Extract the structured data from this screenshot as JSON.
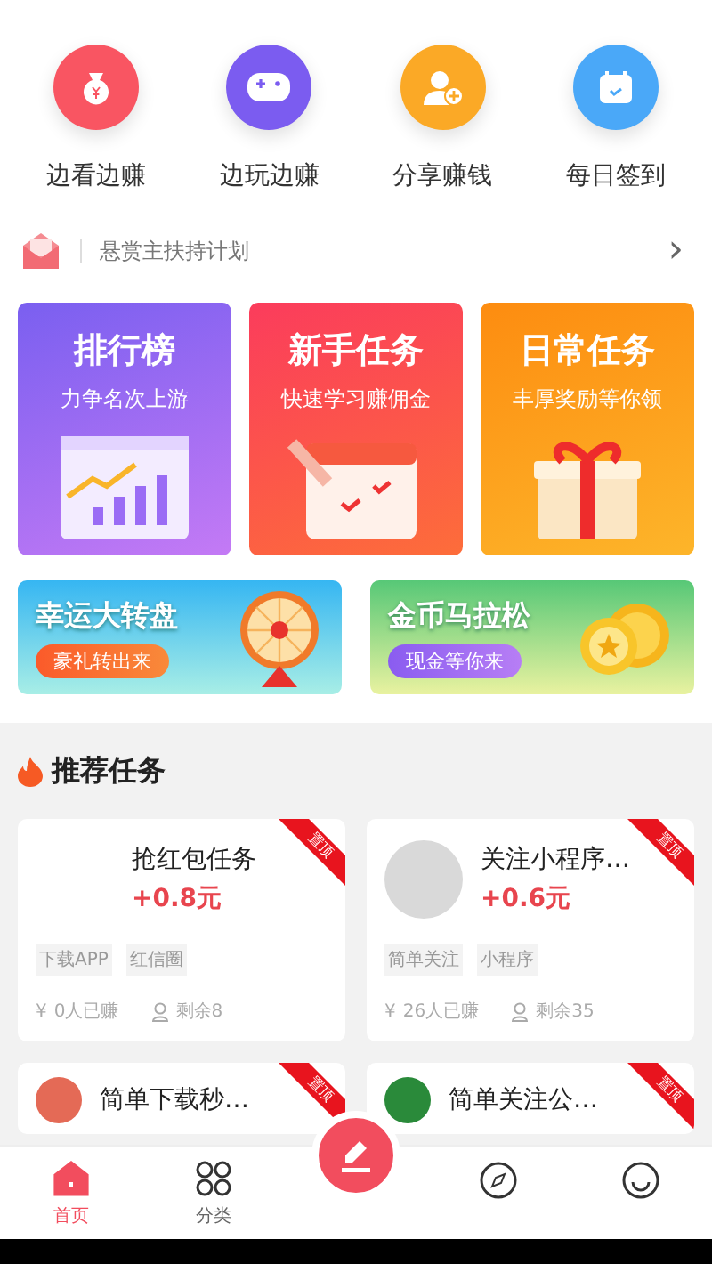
{
  "quick_actions": [
    {
      "label": "边看边赚"
    },
    {
      "label": "边玩边赚"
    },
    {
      "label": "分享赚钱"
    },
    {
      "label": "每日签到"
    }
  ],
  "notice": {
    "text": "悬赏主扶持计划",
    "chevron": "›"
  },
  "feature_cards": [
    {
      "title": "排行榜",
      "subtitle": "力争名次上游"
    },
    {
      "title": "新手任务",
      "subtitle": "快速学习赚佣金"
    },
    {
      "title": "日常任务",
      "subtitle": "丰厚奖励等你领"
    }
  ],
  "promo_banners": [
    {
      "title": "幸运大转盘",
      "button": "豪礼转出来"
    },
    {
      "title": "金币马拉松",
      "button": "现金等你来"
    }
  ],
  "section": {
    "title": "推荐任务"
  },
  "tasks": [
    {
      "title": "抢红包任务",
      "reward": "+0.8元",
      "tags": [
        "下载APP",
        "红信圈"
      ],
      "yen": "¥",
      "earned": "0人已赚",
      "remaining": "剩余8",
      "pinned": true,
      "ribbon": "置顶",
      "avatar": false
    },
    {
      "title": "关注小程序…",
      "reward": "+0.6元",
      "tags": [
        "简单关注",
        "小程序"
      ],
      "yen": "¥",
      "earned": "26人已赚",
      "remaining": "剩余35",
      "pinned": true,
      "ribbon": "置顶",
      "avatar": true
    },
    {
      "title": "简单下载秒…",
      "pinned": true,
      "ribbon": "置顶",
      "avatar": true
    },
    {
      "title": "简单关注公…",
      "pinned": true,
      "ribbon": "置顶",
      "avatar": true
    }
  ],
  "bottom_nav": [
    {
      "kind": "tab",
      "label": "首页",
      "selected": true
    },
    {
      "kind": "tab",
      "label": "分类",
      "selected": false
    },
    {
      "kind": "post",
      "selected": false
    },
    {
      "kind": "tab",
      "selected": false
    },
    {
      "kind": "tab",
      "selected": false
    }
  ]
}
